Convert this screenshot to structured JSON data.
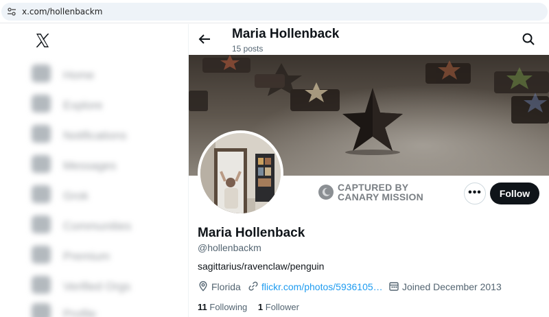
{
  "browser": {
    "url": "x.com/hollenbackm"
  },
  "sidebar": {
    "items": [
      {
        "label": "Home",
        "icon": "home-icon"
      },
      {
        "label": "Explore",
        "icon": "search-icon"
      },
      {
        "label": "Notifications",
        "icon": "bell-icon"
      },
      {
        "label": "Messages",
        "icon": "mail-icon"
      },
      {
        "label": "Grok",
        "icon": "grok-icon"
      },
      {
        "label": "Communities",
        "icon": "communities-icon"
      },
      {
        "label": "Premium",
        "icon": "premium-icon"
      },
      {
        "label": "Verified Orgs",
        "icon": "verified-icon"
      },
      {
        "label": "Profile",
        "icon": "profile-icon"
      }
    ]
  },
  "header": {
    "name": "Maria Hollenback",
    "posts": "15 posts"
  },
  "profile": {
    "captured_line1": "CAPTURED BY",
    "captured_line2": "CANARY MISSION",
    "more_label": "•••",
    "follow_label": "Follow",
    "display_name": "Maria Hollenback",
    "handle": "@hollenbackm",
    "bio": "sagittarius/ravenclaw/penguin",
    "location": "Florida",
    "link": "flickr.com/photos/5936105…",
    "joined": "Joined December 2013",
    "following_count": "11",
    "following_label": "Following",
    "followers_count": "1",
    "followers_label": "Follower"
  },
  "colors": {
    "text": "#0f1419",
    "muted": "#536471",
    "link": "#1d9bf0",
    "follow_bg": "#0f1419"
  }
}
